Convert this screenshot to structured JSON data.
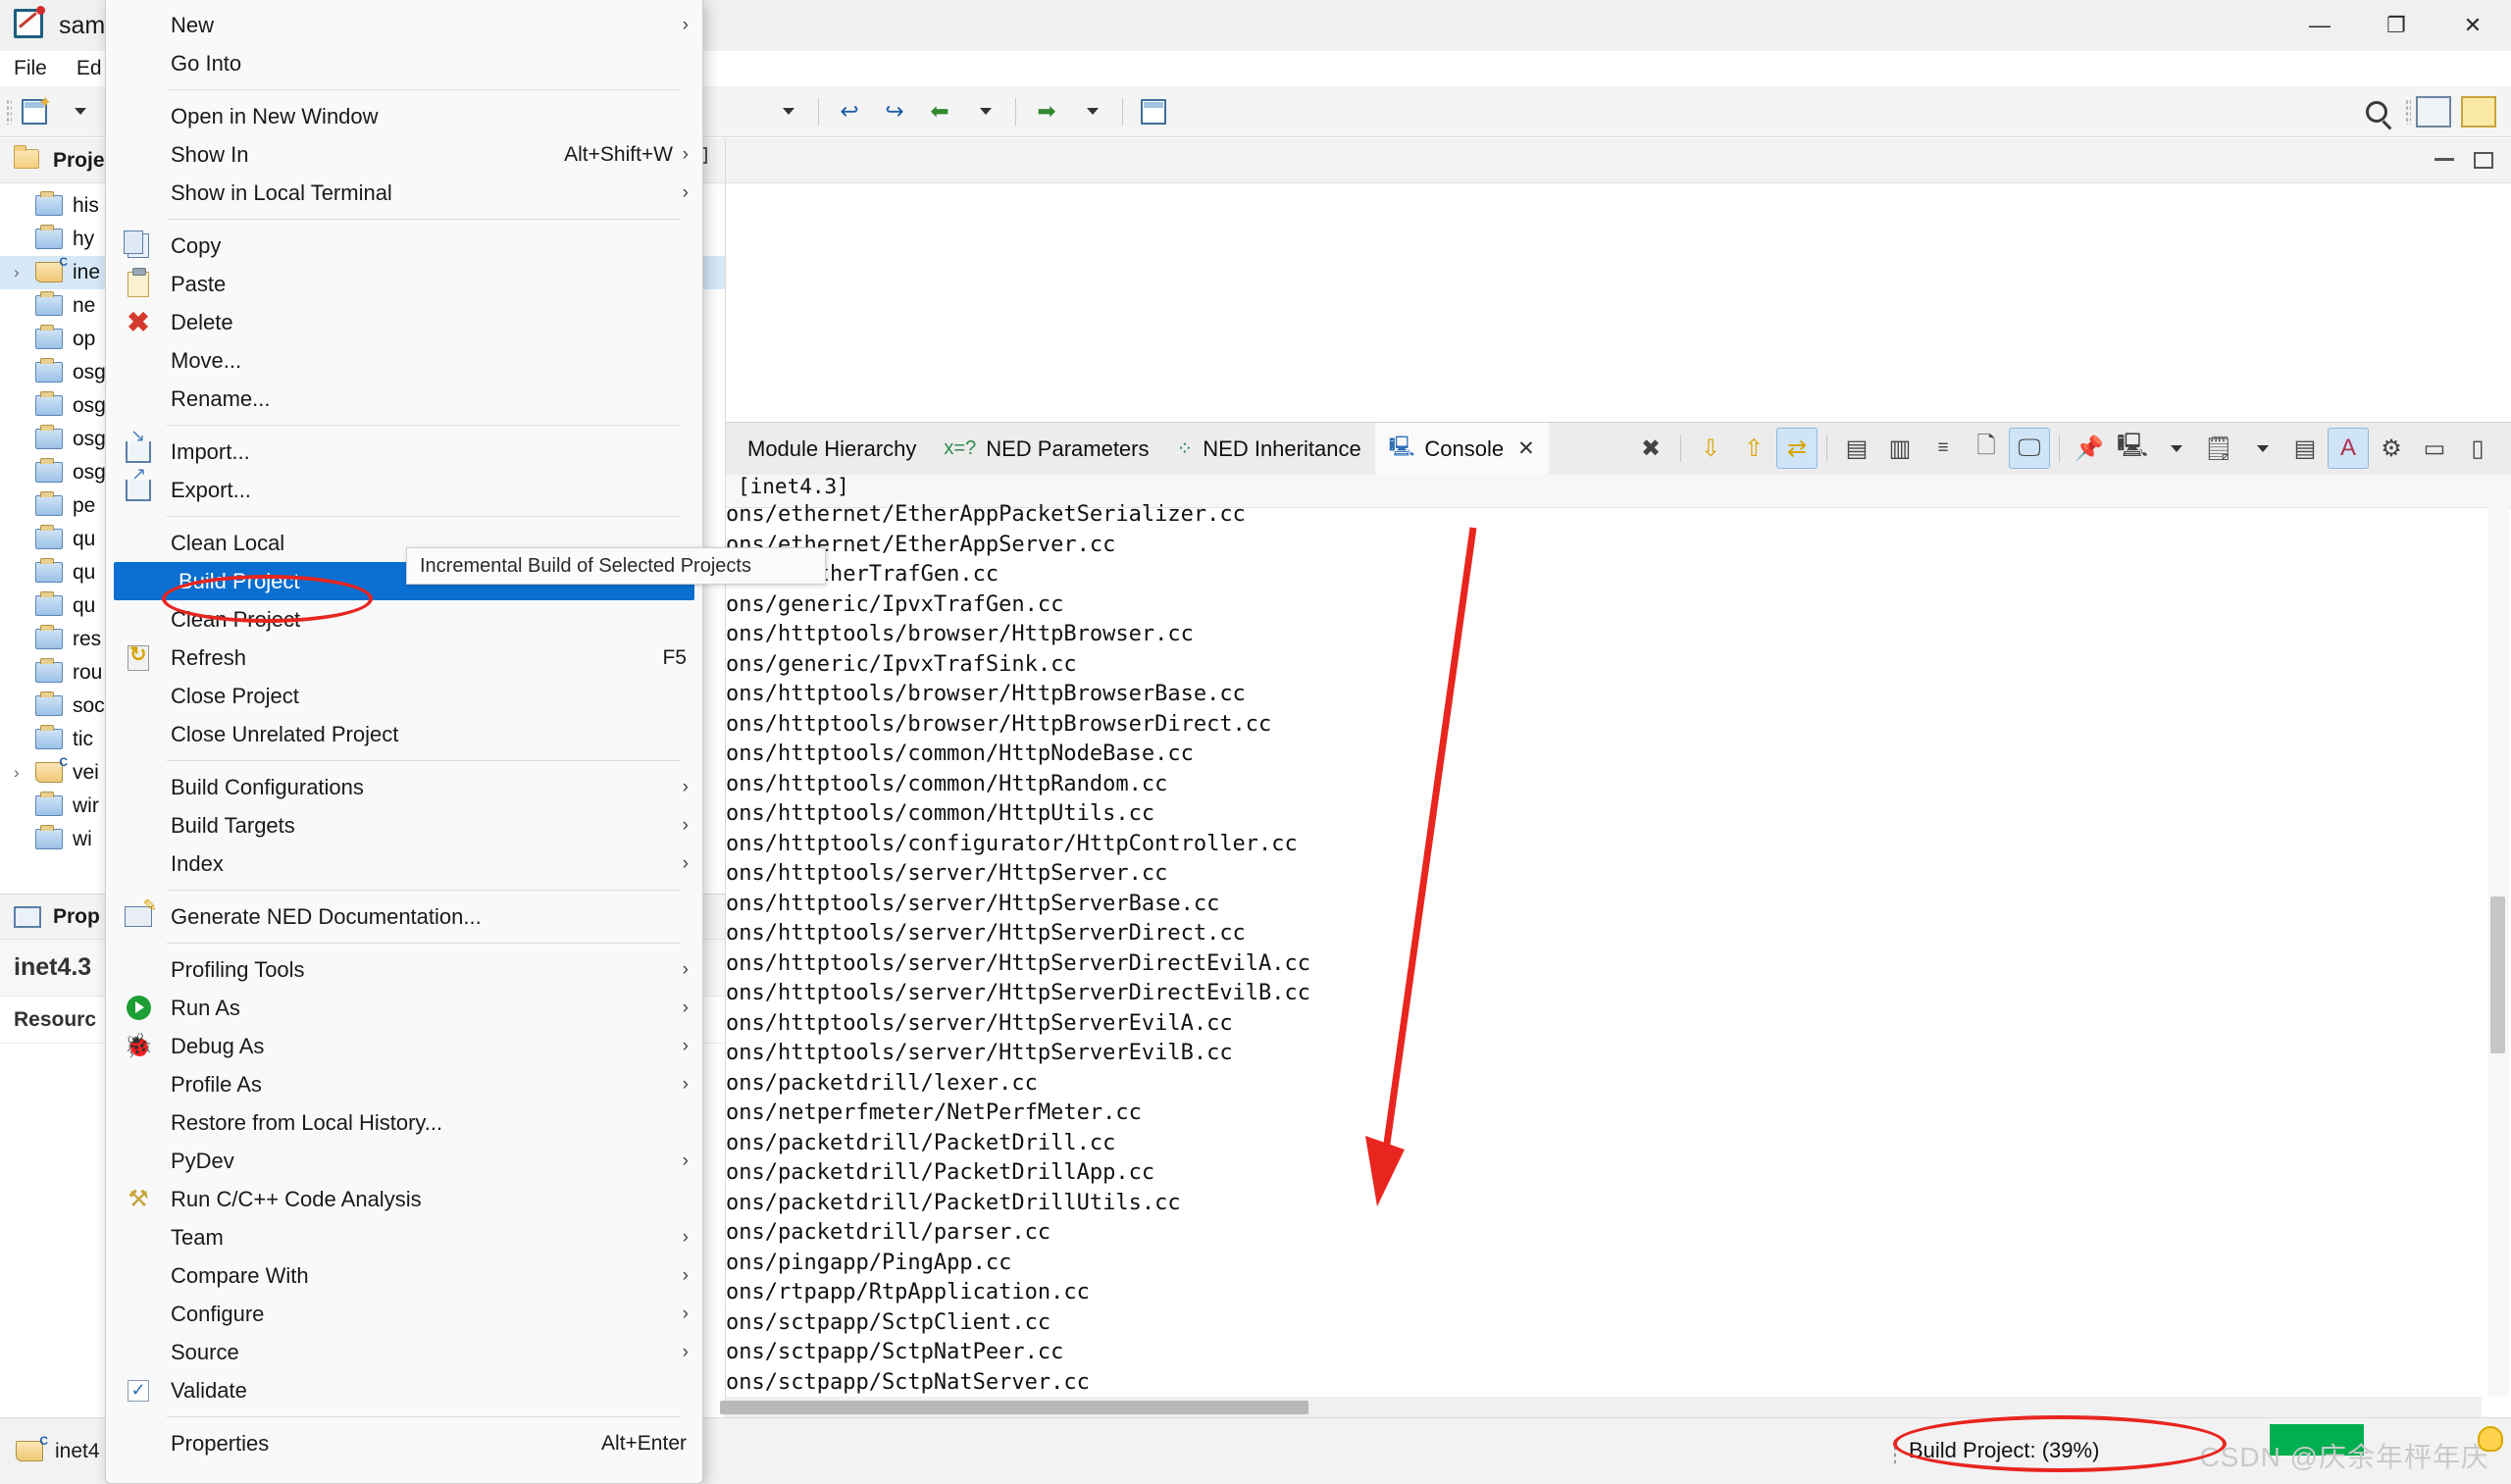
{
  "window": {
    "title": "sample",
    "minimize_label": "—",
    "maximize_label": "❐",
    "close_label": "✕"
  },
  "menubar": {
    "items": [
      "File",
      "Ed"
    ]
  },
  "project_explorer": {
    "title": "Proje",
    "items": [
      {
        "label": "his",
        "icon": "folder-blue",
        "expandable": false,
        "selected": false
      },
      {
        "label": "hy",
        "icon": "folder-blue",
        "expandable": false,
        "selected": false
      },
      {
        "label": "ine",
        "icon": "folder-cpp",
        "expandable": true,
        "selected": true
      },
      {
        "label": "ne",
        "icon": "folder-blue",
        "expandable": false,
        "selected": false
      },
      {
        "label": "op",
        "icon": "folder-blue",
        "expandable": false,
        "selected": false
      },
      {
        "label": "osg",
        "icon": "folder-blue",
        "expandable": false,
        "selected": false
      },
      {
        "label": "osg",
        "icon": "folder-blue",
        "expandable": false,
        "selected": false
      },
      {
        "label": "osg",
        "icon": "folder-blue",
        "expandable": false,
        "selected": false
      },
      {
        "label": "osg",
        "icon": "folder-blue",
        "expandable": false,
        "selected": false
      },
      {
        "label": "pe",
        "icon": "folder-blue",
        "expandable": false,
        "selected": false
      },
      {
        "label": "qu",
        "icon": "folder-blue",
        "expandable": false,
        "selected": false
      },
      {
        "label": "qu",
        "icon": "folder-blue",
        "expandable": false,
        "selected": false
      },
      {
        "label": "qu",
        "icon": "folder-blue",
        "expandable": false,
        "selected": false
      },
      {
        "label": "res",
        "icon": "folder-blue",
        "expandable": false,
        "selected": false
      },
      {
        "label": "rou",
        "icon": "folder-blue",
        "expandable": false,
        "selected": false
      },
      {
        "label": "soc",
        "icon": "folder-blue",
        "expandable": false,
        "selected": false
      },
      {
        "label": "tic",
        "icon": "folder-blue",
        "expandable": false,
        "selected": false
      },
      {
        "label": "vei",
        "icon": "folder-cpp",
        "expandable": true,
        "selected": false
      },
      {
        "label": "wir",
        "icon": "folder-blue",
        "expandable": false,
        "selected": false
      },
      {
        "label": "wi",
        "icon": "folder-blue",
        "expandable": false,
        "selected": false
      }
    ]
  },
  "properties_panel": {
    "title": "Prop",
    "project_name": "inet4.3",
    "section_label": "Resourc"
  },
  "context_menu": {
    "items": [
      {
        "label": "New",
        "icon": null,
        "accel": "",
        "submenu": true,
        "sep_after": false,
        "highlight": false
      },
      {
        "label": "Go Into",
        "icon": null,
        "accel": "",
        "submenu": false,
        "sep_after": true,
        "highlight": false
      },
      {
        "label": "Open in New Window",
        "icon": null,
        "accel": "",
        "submenu": false,
        "sep_after": false,
        "highlight": false
      },
      {
        "label": "Show In",
        "icon": null,
        "accel": "Alt+Shift+W",
        "submenu": true,
        "sep_after": false,
        "highlight": false
      },
      {
        "label": "Show in Local Terminal",
        "icon": null,
        "accel": "",
        "submenu": true,
        "sep_after": true,
        "highlight": false
      },
      {
        "label": "Copy",
        "icon": "copy-icon",
        "accel": "",
        "submenu": false,
        "sep_after": false,
        "highlight": false
      },
      {
        "label": "Paste",
        "icon": "paste-icon",
        "accel": "",
        "submenu": false,
        "sep_after": false,
        "highlight": false
      },
      {
        "label": "Delete",
        "icon": "delete-icon",
        "accel": "",
        "submenu": false,
        "sep_after": false,
        "highlight": false
      },
      {
        "label": "Move...",
        "icon": null,
        "accel": "",
        "submenu": false,
        "sep_after": false,
        "highlight": false
      },
      {
        "label": "Rename...",
        "icon": null,
        "accel": "",
        "submenu": false,
        "sep_after": true,
        "highlight": false
      },
      {
        "label": "Import...",
        "icon": "import-icon",
        "accel": "",
        "submenu": false,
        "sep_after": false,
        "highlight": false
      },
      {
        "label": "Export...",
        "icon": "export-icon",
        "accel": "",
        "submenu": false,
        "sep_after": true,
        "highlight": false
      },
      {
        "label": "Clean Local",
        "icon": null,
        "accel": "",
        "submenu": false,
        "sep_after": false,
        "highlight": false
      },
      {
        "label": "Build Project",
        "icon": null,
        "accel": "",
        "submenu": false,
        "sep_after": false,
        "highlight": true
      },
      {
        "label": "Clean Project",
        "icon": null,
        "accel": "",
        "submenu": false,
        "sep_after": false,
        "highlight": false
      },
      {
        "label": "Refresh",
        "icon": "refresh-icon",
        "accel": "F5",
        "submenu": false,
        "sep_after": false,
        "highlight": false
      },
      {
        "label": "Close Project",
        "icon": null,
        "accel": "",
        "submenu": false,
        "sep_after": false,
        "highlight": false
      },
      {
        "label": "Close Unrelated Project",
        "icon": null,
        "accel": "",
        "submenu": false,
        "sep_after": true,
        "highlight": false
      },
      {
        "label": "Build Configurations",
        "icon": null,
        "accel": "",
        "submenu": true,
        "sep_after": false,
        "highlight": false
      },
      {
        "label": "Build Targets",
        "icon": null,
        "accel": "",
        "submenu": true,
        "sep_after": false,
        "highlight": false
      },
      {
        "label": "Index",
        "icon": null,
        "accel": "",
        "submenu": true,
        "sep_after": true,
        "highlight": false
      },
      {
        "label": "Generate NED Documentation...",
        "icon": "ned-doc-icon",
        "accel": "",
        "submenu": false,
        "sep_after": true,
        "highlight": false
      },
      {
        "label": "Profiling Tools",
        "icon": null,
        "accel": "",
        "submenu": true,
        "sep_after": false,
        "highlight": false
      },
      {
        "label": "Run As",
        "icon": "run-icon",
        "accel": "",
        "submenu": true,
        "sep_after": false,
        "highlight": false
      },
      {
        "label": "Debug As",
        "icon": "bug-icon",
        "accel": "",
        "submenu": true,
        "sep_after": false,
        "highlight": false
      },
      {
        "label": "Profile As",
        "icon": null,
        "accel": "",
        "submenu": true,
        "sep_after": false,
        "highlight": false
      },
      {
        "label": "Restore from Local History...",
        "icon": null,
        "accel": "",
        "submenu": false,
        "sep_after": false,
        "highlight": false
      },
      {
        "label": "PyDev",
        "icon": null,
        "accel": "",
        "submenu": true,
        "sep_after": false,
        "highlight": false
      },
      {
        "label": "Run C/C++ Code Analysis",
        "icon": "analysis-icon",
        "accel": "",
        "submenu": false,
        "sep_after": false,
        "highlight": false
      },
      {
        "label": "Team",
        "icon": null,
        "accel": "",
        "submenu": true,
        "sep_after": false,
        "highlight": false
      },
      {
        "label": "Compare With",
        "icon": null,
        "accel": "",
        "submenu": true,
        "sep_after": false,
        "highlight": false
      },
      {
        "label": "Configure",
        "icon": null,
        "accel": "",
        "submenu": true,
        "sep_after": false,
        "highlight": false
      },
      {
        "label": "Source",
        "icon": null,
        "accel": "",
        "submenu": true,
        "sep_after": false,
        "highlight": false
      },
      {
        "label": "Validate",
        "icon": "validate-check-icon",
        "accel": "",
        "submenu": false,
        "sep_after": true,
        "highlight": false
      },
      {
        "label": "Properties",
        "icon": null,
        "accel": "Alt+Enter",
        "submenu": false,
        "sep_after": false,
        "highlight": false
      }
    ]
  },
  "tooltip": {
    "text": "Incremental Build of Selected Projects"
  },
  "view_tabs": [
    {
      "label": "Module Hierarchy",
      "icon": null,
      "active": false,
      "closable": false
    },
    {
      "label": "NED Parameters",
      "icon": "ned-parameters-icon",
      "active": false,
      "closable": false
    },
    {
      "label": "NED Inheritance",
      "icon": "ned-inheritance-icon",
      "active": false,
      "closable": false
    },
    {
      "label": "Console",
      "icon": "console-icon",
      "active": true,
      "closable": true
    }
  ],
  "console": {
    "header": "[inet4.3]",
    "lines": [
      "ons/ethernet/EtherAppPacketSerializer.cc",
      "ons/ethernet/EtherAppServer.cc",
      "ernet/EtherTrafGen.cc",
      "ons/generic/IpvxTrafGen.cc",
      "ons/httptools/browser/HttpBrowser.cc",
      "ons/generic/IpvxTrafSink.cc",
      "ons/httptools/browser/HttpBrowserBase.cc",
      "ons/httptools/browser/HttpBrowserDirect.cc",
      "ons/httptools/common/HttpNodeBase.cc",
      "ons/httptools/common/HttpRandom.cc",
      "ons/httptools/common/HttpUtils.cc",
      "ons/httptools/configurator/HttpController.cc",
      "ons/httptools/server/HttpServer.cc",
      "ons/httptools/server/HttpServerBase.cc",
      "ons/httptools/server/HttpServerDirect.cc",
      "ons/httptools/server/HttpServerDirectEvilA.cc",
      "ons/httptools/server/HttpServerDirectEvilB.cc",
      "ons/httptools/server/HttpServerEvilA.cc",
      "ons/httptools/server/HttpServerEvilB.cc",
      "ons/packetdrill/lexer.cc",
      "ons/netperfmeter/NetPerfMeter.cc",
      "ons/packetdrill/PacketDrill.cc",
      "ons/packetdrill/PacketDrillApp.cc",
      "ons/packetdrill/PacketDrillUtils.cc",
      "ons/packetdrill/parser.cc",
      "ons/pingapp/PingApp.cc",
      "ons/rtpapp/RtpApplication.cc",
      "ons/sctpapp/SctpClient.cc",
      "ons/sctpapp/SctpNatPeer.cc",
      "ons/sctpapp/SctpNatServer.cc"
    ]
  },
  "console_toolbar_icons": [
    "terminate-all-icon",
    "scroll-down-icon",
    "scroll-up-icon",
    "scroll-lock-icon",
    "clear-console-icon",
    "lock-console-icon",
    "word-wrap-icon",
    "remove-console-icon",
    "remove-all-consoles-icon",
    "pin-console-icon",
    "display-console-icon",
    "display-console-dropdown-icon",
    "open-console-icon",
    "open-console-dropdown-icon",
    "console-options-icon",
    "auto-scroll-icon",
    "settings-gear-icon",
    "minimize-icon",
    "maximize-icon"
  ],
  "status_bar": {
    "project_label": "inet4",
    "build_status": "Build Project: (39%)",
    "watermark": "CSDN @庆余年枰年庆"
  },
  "colors": {
    "highlight_blue": "#0a6fd0",
    "annotation_red": "#e8251f",
    "selection_blue": "#d6e8f7",
    "green_block": "#00b050"
  }
}
